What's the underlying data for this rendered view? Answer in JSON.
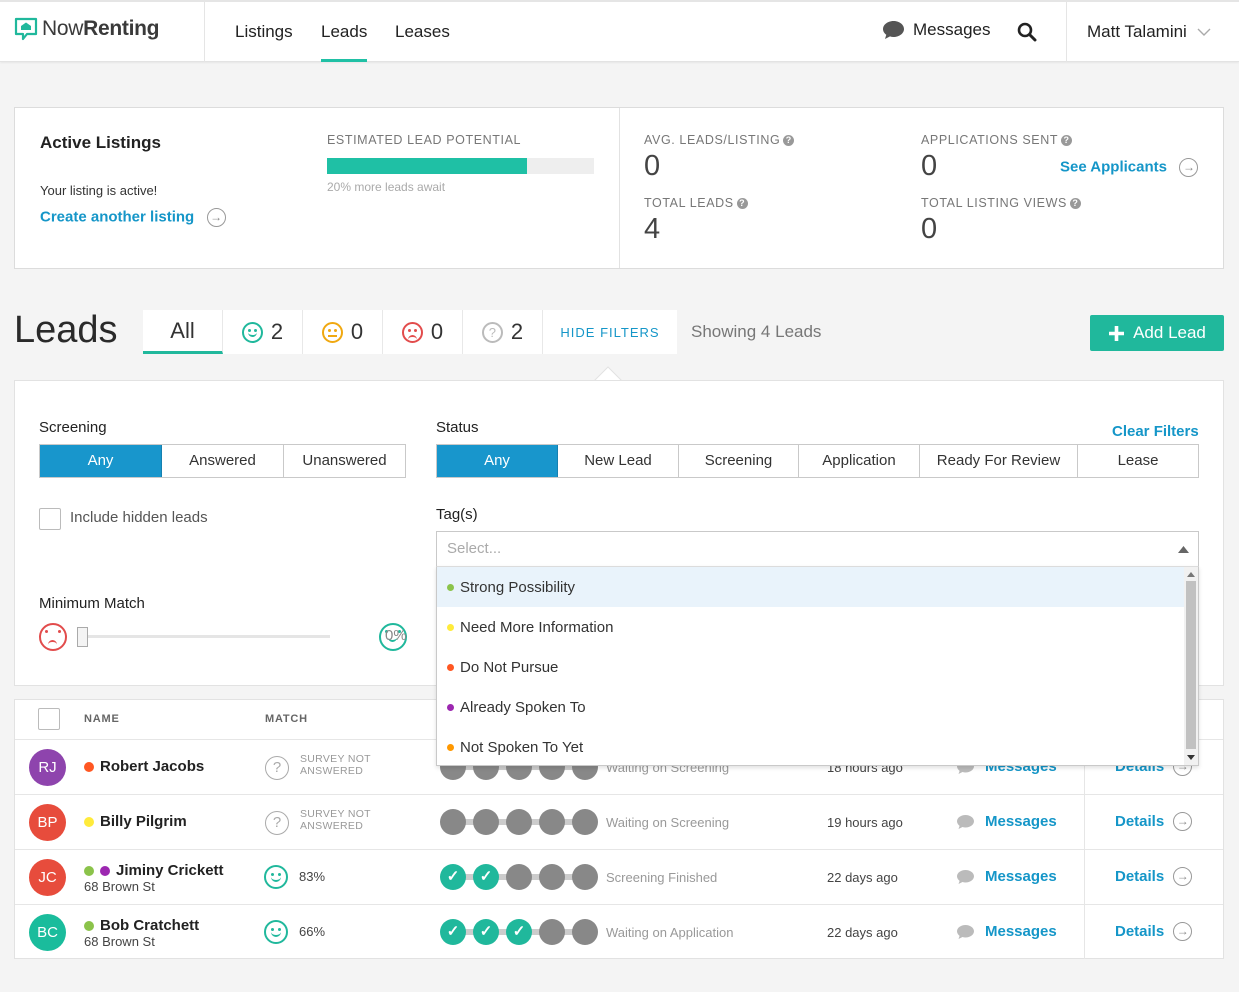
{
  "header": {
    "brand_light": "Now",
    "brand_bold": "Renting",
    "nav": [
      "Listings",
      "Leads",
      "Leases"
    ],
    "active_nav": "Leads",
    "messages_label": "Messages",
    "user_name": "Matt Talamini"
  },
  "stats": {
    "title": "Active Listings",
    "listing_status": "Your listing is active!",
    "create_link": "Create another listing",
    "potential_label": "ESTIMATED LEAD POTENTIAL",
    "potential_fraction": 0.75,
    "potential_note": "20% more leads await",
    "avg_label": "AVG. LEADS/LISTING",
    "avg_value": "0",
    "total_leads_label": "TOTAL LEADS",
    "total_leads_value": "4",
    "apps_label": "APPLICATIONS SENT",
    "apps_value": "0",
    "see_applicants": "See Applicants",
    "views_label": "TOTAL LISTING VIEWS",
    "views_value": "0"
  },
  "leads": {
    "heading": "Leads",
    "tab_all": "All",
    "count_happy": "2",
    "count_neutral": "0",
    "count_sad": "0",
    "count_unknown": "2",
    "hide_filters": "HIDE FILTERS",
    "showing": "Showing 4 Leads",
    "add_lead": "Add Lead"
  },
  "filters": {
    "screening_label": "Screening",
    "screening_options": [
      "Any",
      "Answered",
      "Unanswered"
    ],
    "status_label": "Status",
    "status_options": [
      "Any",
      "New Lead",
      "Screening",
      "Application",
      "Ready For Review",
      "Lease"
    ],
    "clear": "Clear Filters",
    "include_hidden": "Include hidden leads",
    "tags_label": "Tag(s)",
    "tags_placeholder": "Select...",
    "min_match_label": "Minimum Match",
    "min_match_value": "0%",
    "tag_options": [
      {
        "label": "Strong Possibility",
        "color": "#8bc34a"
      },
      {
        "label": "Need More Information",
        "color": "#ffeb3b"
      },
      {
        "label": "Do Not Pursue",
        "color": "#ff5722"
      },
      {
        "label": "Already Spoken To",
        "color": "#9c27b0"
      },
      {
        "label": "Not Spoken To Yet",
        "color": "#ff9800"
      }
    ]
  },
  "table": {
    "col_name": "NAME",
    "col_match": "MATCH",
    "survey_line1": "SURVEY NOT",
    "survey_line2": "ANSWERED",
    "messages": "Messages",
    "details": "Details",
    "rows": [
      {
        "initials": "RJ",
        "avatar_color": "#8e44ad",
        "name": "Robert Jacobs",
        "address": "",
        "tags": [
          "#ff5722"
        ],
        "match": null,
        "steps_done": 0,
        "status": "Waiting on Screening",
        "time": "18 hours ago"
      },
      {
        "initials": "BP",
        "avatar_color": "#e74c3c",
        "name": "Billy Pilgrim",
        "address": "",
        "tags": [
          "#ffeb3b"
        ],
        "match": null,
        "steps_done": 0,
        "status": "Waiting on Screening",
        "time": "19 hours ago"
      },
      {
        "initials": "JC",
        "avatar_color": "#e74c3c",
        "name": "Jiminy Crickett",
        "address": "68 Brown St",
        "tags": [
          "#8bc34a",
          "#9c27b0"
        ],
        "match": "83%",
        "steps_done": 2,
        "status": "Screening Finished",
        "time": "22 days ago"
      },
      {
        "initials": "BC",
        "avatar_color": "#1abc9c",
        "name": "Bob Cratchett",
        "address": "68 Brown St",
        "tags": [
          "#8bc34a"
        ],
        "match": "66%",
        "steps_done": 3,
        "status": "Waiting on Application",
        "time": "22 days ago"
      }
    ]
  }
}
